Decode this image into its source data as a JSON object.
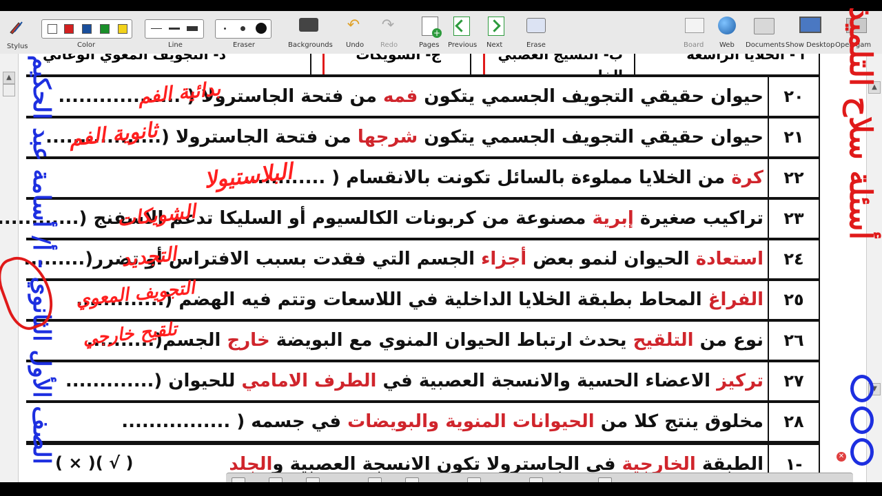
{
  "toolbar": {
    "groups": {
      "stylus": "Stylus",
      "color": "Color",
      "line": "Line",
      "eraser": "Eraser",
      "backgrounds": "Backgrounds",
      "undo": "Undo",
      "redo": "Redo",
      "pages": "Pages",
      "previous": "Previous",
      "next": "Next",
      "erase": "Erase",
      "board": "Board",
      "web": "Web",
      "documents": "Documents",
      "show_desktop": "Show Desktop",
      "open_game": "Open gam"
    },
    "colors": [
      "#d32020",
      "#1a4f9c",
      "#1a8f2a",
      "#f2d21b"
    ],
    "icons": {
      "stylus": "pen-icon",
      "backgrounds": "keyboard-icon",
      "undo": "undo-icon",
      "redo": "redo-icon",
      "pages": "add-page-icon",
      "previous": "previous-page-icon",
      "next": "next-page-icon",
      "erase": "erase-icon",
      "board": "board-icon",
      "web": "globe-icon",
      "documents": "folder-icon",
      "show_desktop": "monitor-icon"
    }
  },
  "top_partial_row": {
    "cells": [
      "أ - الخلايا الراسعة",
      "ب- النسيج العصبي الخاص",
      "ج- الشويكات",
      "د- التجويف المعوي الوعائي"
    ]
  },
  "questions": [
    {
      "num": "٢٠",
      "parts": [
        {
          "t": "حيوان حقيقي التجويف الجسمي يتكون "
        },
        {
          "t": "فمه",
          "red": true
        },
        {
          "t": " من فتحة الجاستروﻻ ( .................."
        }
      ],
      "answer": "بدائية الفم"
    },
    {
      "num": "٢١",
      "parts": [
        {
          "t": "حيوان حقيقي التجويف الجسمي يتكون "
        },
        {
          "t": "شرجها",
          "red": true
        },
        {
          "t": "  من فتحة الجاستروﻻ (................."
        }
      ],
      "answer": "ثانوية الفم"
    },
    {
      "num": "٢٢",
      "parts": [
        {
          "t": "كرة",
          "red": true
        },
        {
          "t": " من الخلايا مملوءة بالسائل تكونت بالانقسام ( ............"
        }
      ],
      "answer": "البلاستيولا"
    },
    {
      "num": "٢٣",
      "parts": [
        {
          "t": "تراكيب صغيرة "
        },
        {
          "t": "إبرية",
          "red": true
        },
        {
          "t": " مصنوعة من كربونات الكالسيوم أو السليكا تدعم الاسفنج  (............"
        }
      ],
      "answer": "الشويكات"
    },
    {
      "num": "٢٤",
      "parts": [
        {
          "t": "استعادة",
          "red": true
        },
        {
          "t": " الحيوان لنمو بعض "
        },
        {
          "t": "أجزاء",
          "red": true
        },
        {
          "t": " الجسم التي فقدت بسبب الافتراس أو تضرر(........."
        }
      ],
      "answer": "التجديد"
    },
    {
      "num": "٢٥",
      "parts": [
        {
          "t": "الفراغ",
          "red": true
        },
        {
          "t": " المحاط بطبقة الخلايا الداخلية في اللاسعات وتتم فيه الهضم (............."
        }
      ],
      "answer": "التجويف المعوي"
    },
    {
      "num": "٢٦",
      "parts": [
        {
          "t": "نوع من "
        },
        {
          "t": "التلقيح",
          "red": true
        },
        {
          "t": " يحدث ارتباط الحيوان المنوي مع البويضة "
        },
        {
          "t": "خارج",
          "red": true
        },
        {
          "t": " الجسم(.........."
        }
      ],
      "answer": "تلقيح خارجي"
    },
    {
      "num": "٢٧",
      "parts": [
        {
          "t": "تركيز",
          "red": true
        },
        {
          "t": " الاعضاء الحسية والانسجة العصبية في "
        },
        {
          "t": "الطرف الامامي",
          "red": true
        },
        {
          "t": " للحيوان (............."
        }
      ],
      "answer": ""
    },
    {
      "num": "٢٨",
      "parts": [
        {
          "t": "مخلوق ينتج كلا من "
        },
        {
          "t": "الحيوانات المنوية والبويضات",
          "red": true
        },
        {
          "t": " في جسمه ( ................"
        }
      ],
      "answer": ""
    }
  ],
  "section_row": {
    "num": "١-",
    "parts": [
      {
        "t": "الطبقة "
      },
      {
        "t": "الخارجية",
        "red": true
      },
      {
        "t": " في الجاستروﻻ تكون الانسجة العصبية و"
      },
      {
        "t": "الجلد",
        "red": true
      }
    ],
    "choices": "( × )( √ )"
  },
  "side_notes": {
    "left_vertical": "الصف الأول الثانوي - أ/ أسامة عبد الحكيم",
    "right_vertical": "أسئلة سلاح التلميذ"
  }
}
